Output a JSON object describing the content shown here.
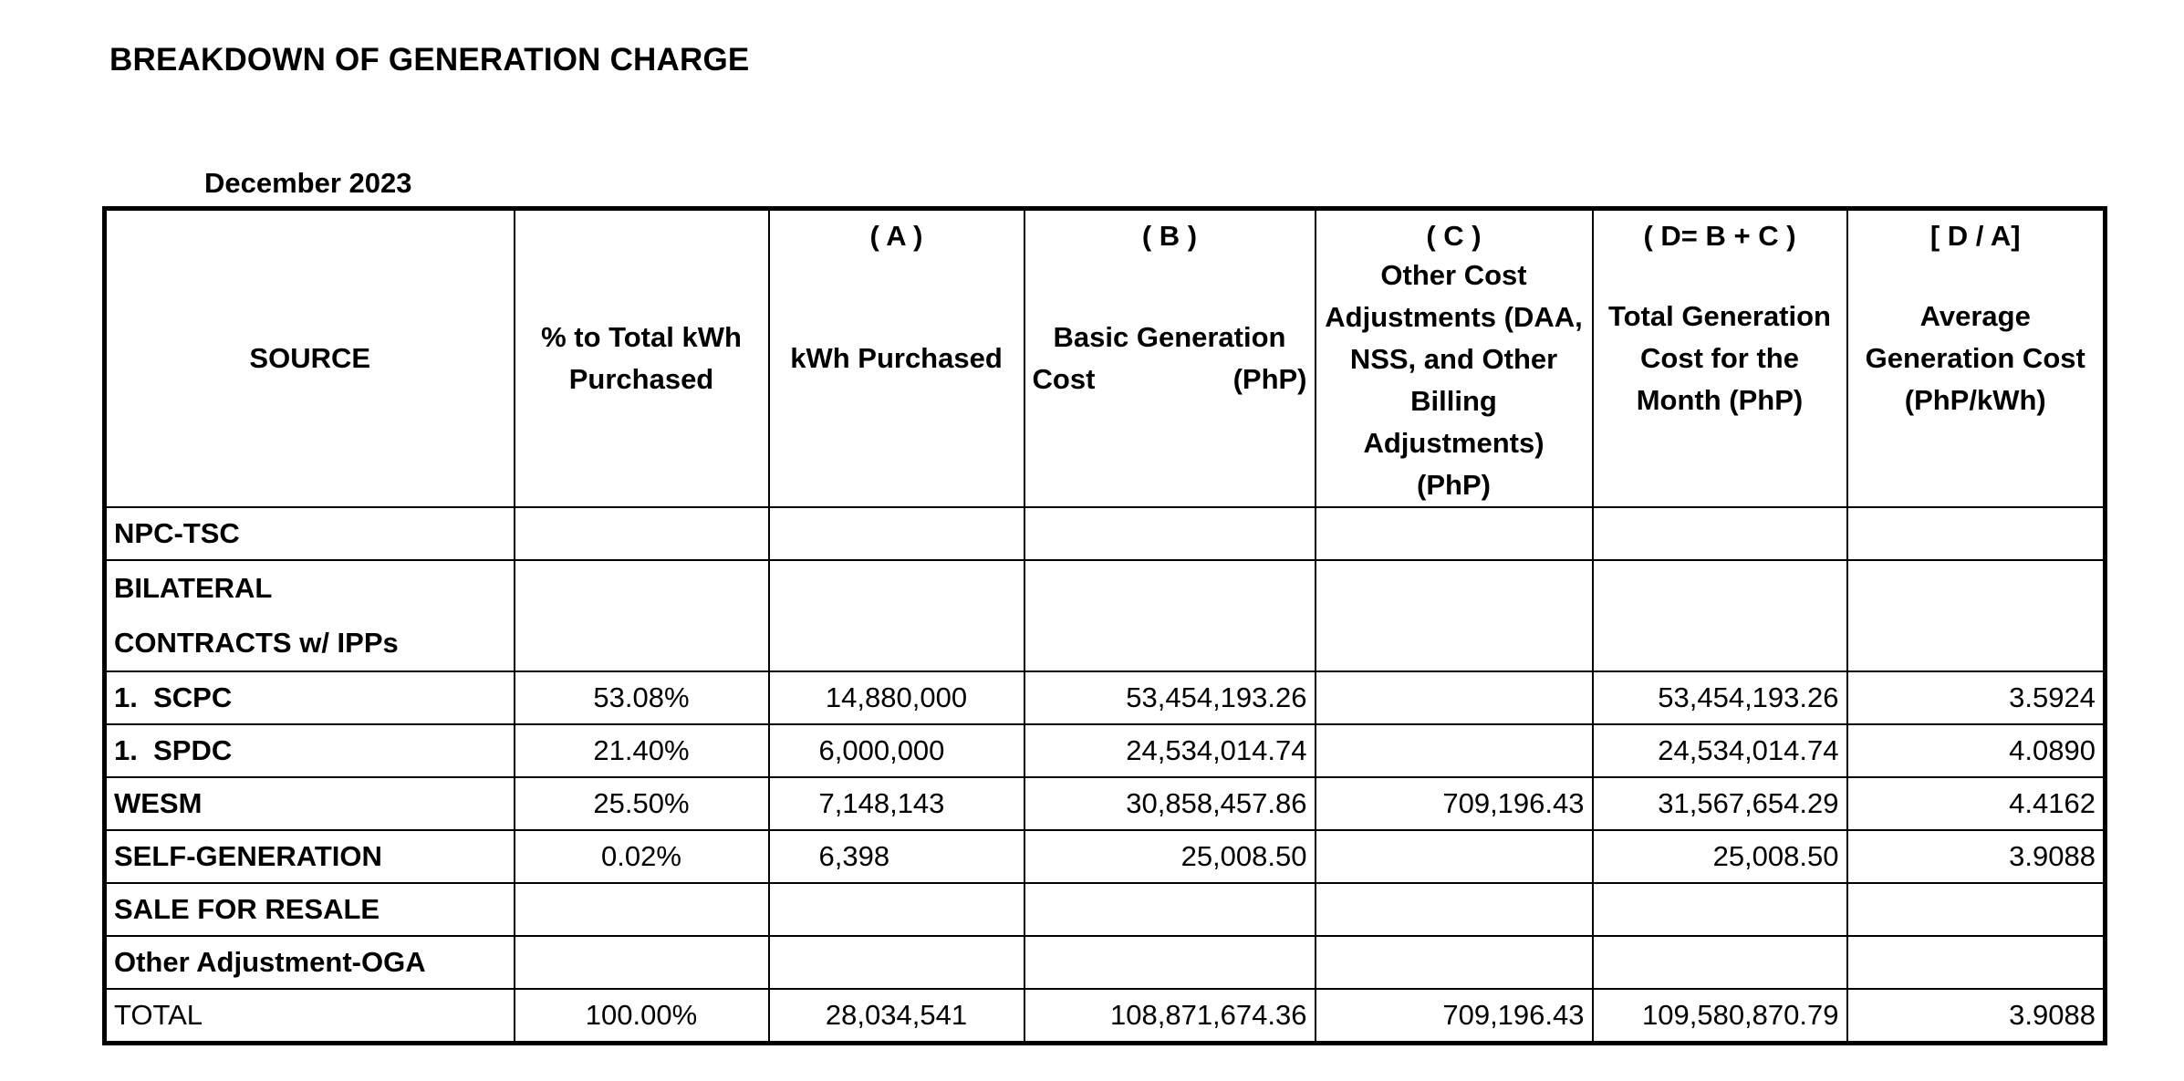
{
  "title": "BREAKDOWN OF GENERATION CHARGE",
  "period": "December 2023",
  "columns": [
    {
      "letter": "",
      "label": "SOURCE"
    },
    {
      "letter": "",
      "label": "% to Total kWh Purchased"
    },
    {
      "letter": "( A )",
      "label": "kWh Purchased"
    },
    {
      "letter": "( B )",
      "label_top": "Basic Generation",
      "label_left": "Cost",
      "label_right": "(PhP)"
    },
    {
      "letter": "( C )",
      "label": "Other Cost Adjustments (DAA, NSS, and Other Billing Adjustments) (PhP)"
    },
    {
      "letter": "( D= B + C )",
      "label": "Total Generation Cost for the Month (PhP)"
    },
    {
      "letter": "[ D / A]",
      "label": "Average Generation Cost (PhP/kWh)"
    }
  ],
  "rows": {
    "npc": {
      "source": "NPC-TSC"
    },
    "bilateral": {
      "source_line1": "BILATERAL",
      "source_line2": "CONTRACTS w/ IPPs"
    },
    "scpc": {
      "num": "1.",
      "source": "SCPC",
      "pct": "53.08%",
      "kwh": "14,880,000",
      "basic": "53,454,193.26",
      "other": "",
      "total": "53,454,193.26",
      "avg": "3.5924"
    },
    "spdc": {
      "num": "1.",
      "source": "SPDC",
      "pct": "21.40%",
      "kwh": "6,000,000",
      "basic": "24,534,014.74",
      "other": "",
      "total": "24,534,014.74",
      "avg": "4.0890"
    },
    "wesm": {
      "source": "WESM",
      "pct": "25.50%",
      "kwh": "7,148,143",
      "basic": "30,858,457.86",
      "other": "709,196.43",
      "total": "31,567,654.29",
      "avg": "4.4162"
    },
    "selfgen": {
      "source": "SELF-GENERATION",
      "pct": "0.02%",
      "kwh": "6,398",
      "basic": "25,008.50",
      "other": "",
      "total": "25,008.50",
      "avg": "3.9088"
    },
    "resale": {
      "source": "SALE FOR RESALE"
    },
    "oga": {
      "source": "Other Adjustment-OGA"
    },
    "total": {
      "source": "TOTAL",
      "pct": "100.00%",
      "kwh": "28,034,541",
      "basic": "108,871,674.36",
      "other": "709,196.43",
      "total": "109,580,870.79",
      "avg": "3.9088"
    }
  }
}
